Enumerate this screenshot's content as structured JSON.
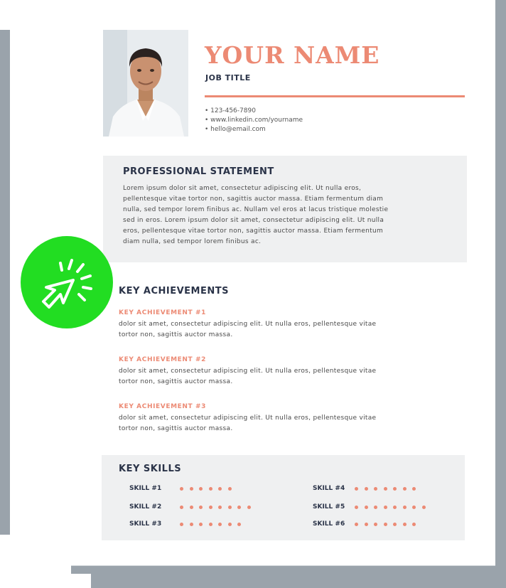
{
  "header": {
    "name": "YOUR NAME",
    "job_title": "JOB TITLE",
    "contacts": [
      "• 123-456-7890",
      "• www.linkedin.com/yourname",
      "• hello@email.com"
    ]
  },
  "statement": {
    "heading": "PROFESSIONAL STATEMENT",
    "lines": [
      "Lorem ipsum dolor sit amet, consectetur adipiscing elit. Ut nulla eros,",
      "pellentesque vitae tortor non, sagittis auctor massa. Etiam fermentum diam",
      "nulla, sed tempor lorem finibus ac. Nullam vel eros at lacus tristique molestie",
      "sed in eros. Lorem ipsum dolor sit amet, consectetur adipiscing elit. Ut nulla",
      "eros, pellentesque vitae tortor non, sagittis auctor massa. Etiam fermentum",
      "diam nulla, sed tempor lorem finibus ac."
    ]
  },
  "achievements": {
    "heading": "KEY ACHIEVEMENTS",
    "items": [
      {
        "title": "KEY ACHIEVEMENT #1",
        "line1": "dolor sit amet, consectetur adipiscing elit. Ut nulla eros, pellentesque vitae",
        "line2": "tortor non, sagittis auctor massa."
      },
      {
        "title": "KEY ACHIEVEMENT #2",
        "line1": "dolor sit amet, consectetur adipiscing elit. Ut nulla eros, pellentesque vitae",
        "line2": "tortor non, sagittis auctor massa."
      },
      {
        "title": "KEY ACHIEVEMENT #3",
        "line1": "dolor sit amet, consectetur adipiscing elit. Ut nulla eros, pellentesque vitae",
        "line2": "tortor non, sagittis auctor massa."
      }
    ]
  },
  "skills": {
    "heading": "KEY SKILLS",
    "items": [
      {
        "label": "SKILL #1",
        "dots": 6
      },
      {
        "label": "SKILL #2",
        "dots": 8
      },
      {
        "label": "SKILL #3",
        "dots": 7
      },
      {
        "label": "SKILL #4",
        "dots": 7
      },
      {
        "label": "SKILL #5",
        "dots": 8
      },
      {
        "label": "SKILL #6",
        "dots": 7
      }
    ]
  },
  "colors": {
    "accent": "#ec8a74",
    "heading": "#2a3348",
    "section_bg": "#eff0f1",
    "badge": "#22dd22"
  },
  "icons": {
    "badge": "cursor-click-icon",
    "photo": "profile-photo"
  }
}
